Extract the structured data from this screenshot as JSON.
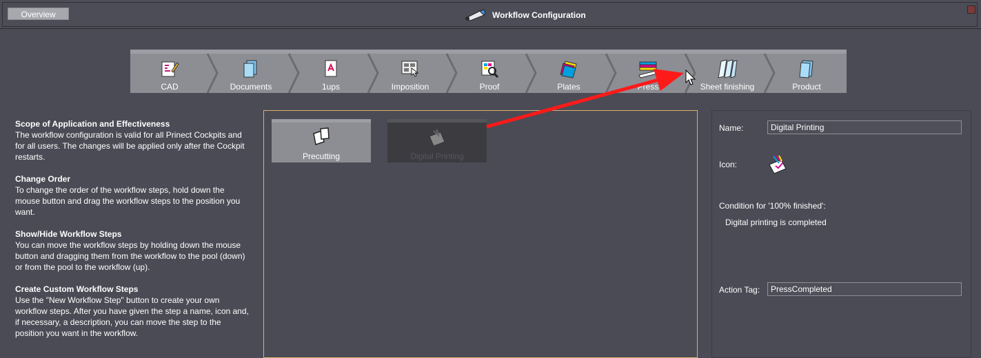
{
  "header": {
    "overview_label": "Overview",
    "title": "Workflow Configuration"
  },
  "steps": [
    {
      "label": "CAD",
      "icon": "cad-icon"
    },
    {
      "label": "Documents",
      "icon": "documents-icon"
    },
    {
      "label": "1ups",
      "icon": "pdf-1up-icon"
    },
    {
      "label": "Imposition",
      "icon": "imposition-icon"
    },
    {
      "label": "Proof",
      "icon": "proof-icon"
    },
    {
      "label": "Plates",
      "icon": "plates-icon"
    },
    {
      "label": "Press",
      "icon": "press-icon"
    },
    {
      "label": "Sheet finishing",
      "icon": "sheet-finishing-icon"
    },
    {
      "label": "Product",
      "icon": "product-icon"
    }
  ],
  "help": {
    "sections": [
      {
        "heading": "Scope of Application and Effectiveness",
        "body": "The workflow configuration is valid for all Prinect Cockpits and for all users. The changes will be applied only after the Cockpit restarts."
      },
      {
        "heading": "Change Order",
        "body": "To change the order of the workflow steps, hold down the mouse button and drag the workflow steps to the position you want."
      },
      {
        "heading": "Show/Hide Workflow Steps",
        "body": "You can move the workflow steps by holding down the mouse button and dragging them from the workflow to the pool (down) or from the pool to the workflow (up)."
      },
      {
        "heading": "Create Custom Workflow Steps",
        "body": "Use the \"New Workflow Step\" button to create your own workflow steps. After you have given the step a name, icon and, if necessary, a description, you can move the step to the position you want in the workflow."
      }
    ]
  },
  "pool": {
    "tiles": [
      {
        "label": "Precutting",
        "icon": "precutting-icon",
        "selected": false
      },
      {
        "label": "Digital Printing",
        "icon": "digital-printing-icon",
        "selected": true
      }
    ]
  },
  "details": {
    "name_label": "Name:",
    "name_value": "Digital Printing",
    "icon_label": "Icon:",
    "icon": "digital-printing-icon",
    "condition_label": "Condition for '100% finished':",
    "condition_value": "Digital printing is completed",
    "action_tag_label": "Action Tag:",
    "action_tag_value": "PressCompleted"
  },
  "colors": {
    "background": "#4a4b55",
    "step_bar": "#8d8e94",
    "pool_border": "#e0b070",
    "annotation_arrow": "#ff1a1a"
  }
}
